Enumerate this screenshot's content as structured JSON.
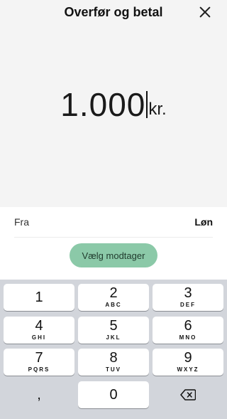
{
  "header": {
    "title": "Overfør og betal",
    "close_icon": "close-icon"
  },
  "amount": {
    "value": "1.000",
    "currency": "kr."
  },
  "from": {
    "label": "Fra",
    "account": "Løn"
  },
  "choose_recipient": {
    "label": "Vælg modtager",
    "color": "#8bc9a8"
  },
  "keypad": {
    "keys": [
      {
        "digit": "1",
        "letters": ""
      },
      {
        "digit": "2",
        "letters": "ABC"
      },
      {
        "digit": "3",
        "letters": "DEF"
      },
      {
        "digit": "4",
        "letters": "GHI"
      },
      {
        "digit": "5",
        "letters": "JKL"
      },
      {
        "digit": "6",
        "letters": "MNO"
      },
      {
        "digit": "7",
        "letters": "PQRS"
      },
      {
        "digit": "8",
        "letters": "TUV"
      },
      {
        "digit": "9",
        "letters": "WXYZ"
      },
      {
        "digit": "0",
        "letters": ""
      }
    ],
    "comma": ",",
    "backspace_icon": "backspace-icon"
  }
}
